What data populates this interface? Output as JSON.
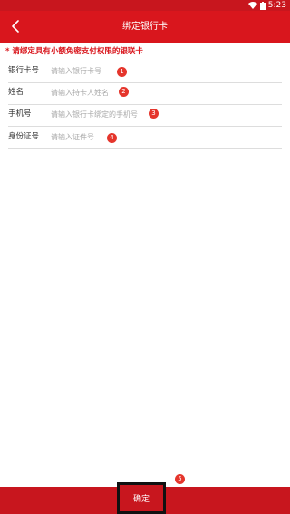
{
  "status_bar": {
    "wifi_icon": "wifi-icon",
    "battery_icon": "battery-icon",
    "time": "5:23"
  },
  "app_bar": {
    "back_icon": "chevron-left-icon",
    "title": "绑定银行卡"
  },
  "notice": "* 请绑定具有小额免密支付权限的银联卡",
  "form": {
    "fields": [
      {
        "label": "银行卡号",
        "placeholder": "请输入银行卡号",
        "badge": "1"
      },
      {
        "label": "姓名",
        "placeholder": "请输入持卡人姓名",
        "badge": "2"
      },
      {
        "label": "手机号",
        "placeholder": "请输入银行卡绑定的手机号",
        "badge": "3"
      },
      {
        "label": "身份证号",
        "placeholder": "请输入证件号",
        "badge": "4"
      }
    ]
  },
  "confirm": {
    "label": "确定",
    "badge": "5"
  },
  "colors": {
    "brand_red": "#d9161d",
    "badge_red": "#e5352c"
  }
}
